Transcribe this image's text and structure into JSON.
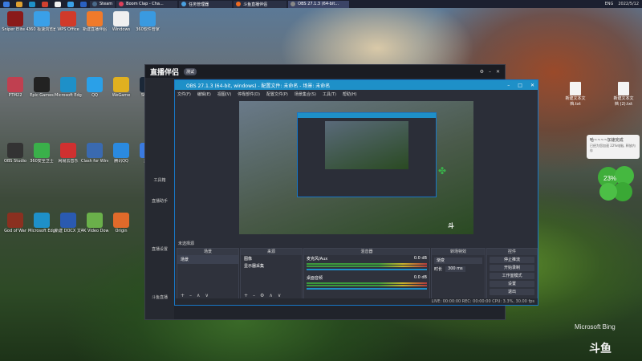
{
  "taskbar": {
    "tabs": [
      {
        "label": "Steam",
        "color": "#1b2838"
      },
      {
        "label": "Boom Clap - Cha...",
        "color": "#e0405a"
      },
      {
        "label": "任务管理器",
        "color": "#4aa0e0"
      },
      {
        "label": "斗鱼直播伴侣",
        "color": "#ee6a20"
      },
      {
        "label": "OBS 27.1.3 (64-bit...",
        "color": "#444"
      }
    ],
    "tray": {
      "lang": "ENG",
      "time": "2022/5/12"
    }
  },
  "desktop_icons": [
    {
      "label": "Sniper Elite 4",
      "color": "#8a1a1a"
    },
    {
      "label": "360 极速浏览器X",
      "color": "#3aa0e8"
    },
    {
      "label": "WPS Office",
      "color": "#d03a2a"
    },
    {
      "label": "新建直播伴侣",
      "color": "#f07a2a"
    },
    {
      "label": "Windows",
      "color": "#f0f0f0"
    },
    {
      "label": "360软件管家",
      "color": "#3a9ae0"
    },
    {
      "label": "PTM22",
      "color": "#c04050"
    },
    {
      "label": "Epic Games",
      "color": "#222"
    },
    {
      "label": "Microsoft Edge",
      "color": "#1e90c8"
    },
    {
      "label": "QQ",
      "color": "#2aa0e8"
    },
    {
      "label": "WeGame",
      "color": "#e0b020"
    },
    {
      "label": "Steam",
      "color": "#1b2838"
    },
    {
      "label": "OBS Studio",
      "color": "#333"
    },
    {
      "label": "360安全卫士",
      "color": "#3ab04a"
    },
    {
      "label": "网易云音乐",
      "color": "#d03030"
    },
    {
      "label": "Clash for Windows",
      "color": "#3a6ab0"
    },
    {
      "label": "腾讯QQ",
      "color": "#2a8ae0"
    },
    {
      "label": "迅雷",
      "color": "#3a7ae0"
    },
    {
      "label": "God of War",
      "color": "#8a3020"
    },
    {
      "label": "Microsoft Edge",
      "color": "#1e90c8"
    },
    {
      "label": "新建 DOCX 文档.docx",
      "color": "#2a5ab0"
    },
    {
      "label": "4K Video Downloader",
      "color": "#6ab04a"
    },
    {
      "label": "Origin",
      "color": "#e06a2a"
    }
  ],
  "host_app": {
    "logo": "直播伴侣",
    "badge": "测试",
    "side_items": [
      "工具箱",
      "直播助手",
      "直播设置"
    ],
    "side_bottom": "斗鱼直播"
  },
  "obs": {
    "title": "OBS 27.1.3 (64-bit, windows) - 配置文件: 未命名 - 场景: 未命名",
    "menu": [
      "文件(F)",
      "编辑(E)",
      "视图(V)",
      "停靠部件(D)",
      "配置文件(P)",
      "场景集合(S)",
      "工具(T)",
      "帮助(H)"
    ],
    "docks": {
      "scenes": {
        "title": "场景",
        "items": [
          "场景"
        ]
      },
      "sources": {
        "title": "来源",
        "items": [
          "图像",
          "显示器采集"
        ]
      },
      "mixer": {
        "title": "混音器",
        "tracks": [
          {
            "name": "麦克风/Aux",
            "db": "0.0 dB"
          },
          {
            "name": "桌面音频",
            "db": "0.0 dB"
          }
        ]
      },
      "transitions": {
        "title": "转场特效",
        "mode": "渐变",
        "duration_label": "时长",
        "duration": "300 ms"
      },
      "controls": {
        "title": "控件",
        "buttons": [
          "停止推流",
          "开始录制",
          "工作室模式",
          "设置",
          "退出"
        ]
      }
    },
    "no_source": "未选择源",
    "status": "LIVE: 00:00:00  REC: 00:00:00  CPU: 3.3%, 30.00 fps"
  },
  "widget": {
    "title": "哈~~~~加速完成",
    "sub": "已经为您加速 22%电脑, 释放内存"
  },
  "clover_percent": "23%",
  "right_files": [
    {
      "label": "新建文本文档.txt"
    },
    {
      "label": "新建文本文档 (2).txt"
    }
  ],
  "watermarks": {
    "bing": "Microsoft Bing",
    "douyu": "斗鱼"
  }
}
